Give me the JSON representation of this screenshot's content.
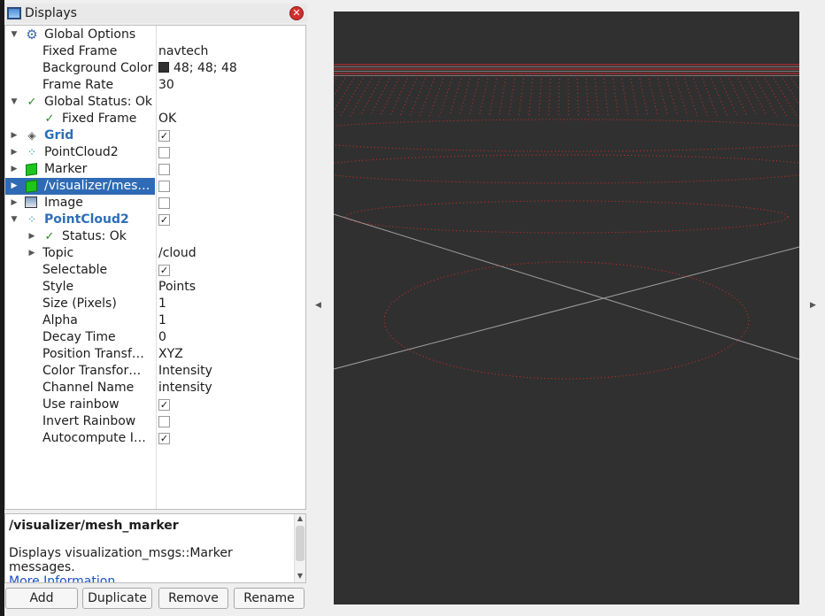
{
  "panel": {
    "title": "Displays",
    "icon": "monitor-icon",
    "close_icon": "close-icon"
  },
  "tree": {
    "global_options": {
      "label": "Global Options",
      "icon": "gear-icon"
    },
    "fixed_frame": {
      "label": "Fixed Frame",
      "value": "navtech"
    },
    "background_color": {
      "label": "Background Color",
      "value": "48; 48; 48",
      "swatch_color": "#303030"
    },
    "frame_rate": {
      "label": "Frame Rate",
      "value": "30"
    },
    "global_status": {
      "label": "Global Status: Ok",
      "icon": "check-icon"
    },
    "status_fixed_frame": {
      "label": "Fixed Frame",
      "value": "OK"
    },
    "grid": {
      "label": "Grid",
      "icon": "grid-icon",
      "checked": true
    },
    "pointcloud2_a": {
      "label": "PointCloud2",
      "icon": "pointcloud-icon",
      "checked": false
    },
    "marker": {
      "label": "Marker",
      "icon": "marker-cube-icon",
      "checked": false
    },
    "mesh_marker": {
      "label": "/visualizer/mes…",
      "icon": "marker-cube-icon",
      "checked": false,
      "selected": true
    },
    "image": {
      "label": "Image",
      "icon": "image-icon",
      "checked": false
    },
    "pointcloud2_b": {
      "label": "PointCloud2",
      "icon": "pointcloud-icon",
      "checked": true
    },
    "status_ok": {
      "label": "Status: Ok",
      "icon": "check-icon"
    },
    "topic": {
      "label": "Topic",
      "value": "/cloud"
    },
    "selectable": {
      "label": "Selectable",
      "checked": true
    },
    "style": {
      "label": "Style",
      "value": "Points"
    },
    "size_pixels": {
      "label": "Size (Pixels)",
      "value": "1"
    },
    "alpha": {
      "label": "Alpha",
      "value": "1"
    },
    "decay_time": {
      "label": "Decay Time",
      "value": "0"
    },
    "position_transform": {
      "label": "Position Transf…",
      "value": "XYZ"
    },
    "color_transform": {
      "label": "Color Transfor…",
      "value": "Intensity"
    },
    "channel_name": {
      "label": "Channel Name",
      "value": "intensity"
    },
    "use_rainbow": {
      "label": "Use rainbow",
      "checked": true
    },
    "invert_rainbow": {
      "label": "Invert Rainbow",
      "checked": false
    },
    "autocompute": {
      "label": "Autocompute I…",
      "checked": true
    }
  },
  "description": {
    "title": "/visualizer/mesh_marker",
    "text": "Displays visualization_msgs::Marker messages.",
    "link": "More Information",
    "link_suffix": "."
  },
  "buttons": {
    "add": "Add",
    "duplicate": "Duplicate",
    "remove": "Remove",
    "rename": "Rename"
  },
  "viewport": {
    "background_color": "#303030",
    "point_color": "#ff2a2a",
    "grid_color": "#a0a0a0"
  }
}
